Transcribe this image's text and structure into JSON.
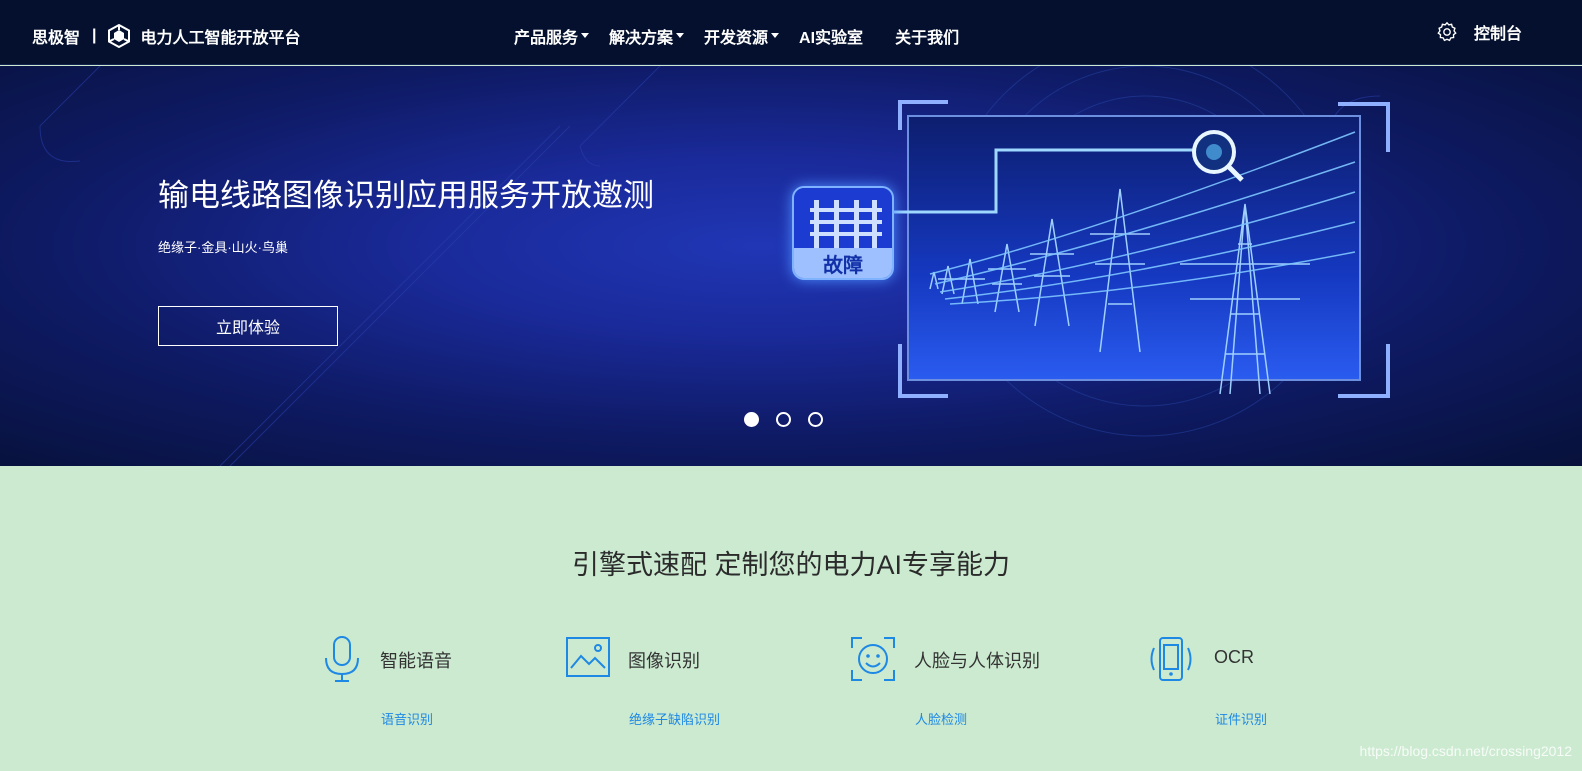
{
  "nav": {
    "brand_name": "思极智",
    "separator": "|",
    "platform_name": "电力人工智能开放平台",
    "menu": [
      {
        "label": "产品服务",
        "has_dropdown": true
      },
      {
        "label": "解决方案",
        "has_dropdown": true
      },
      {
        "label": "开发资源",
        "has_dropdown": true
      },
      {
        "label": "AI实验室",
        "has_dropdown": false
      },
      {
        "label": "关于我们",
        "has_dropdown": false
      }
    ],
    "console_label": "控制台",
    "console_icon": "gear-icon"
  },
  "hero": {
    "title": "输电线路图像识别应用服务开放邀测",
    "subtitle": "绝缘子·金具·山火·鸟巢",
    "button_label": "立即体验",
    "badge_label": "故障",
    "carousel_active_index": 0,
    "carousel_count": 3
  },
  "features": {
    "title": "引擎式速配 定制您的电力AI专享能力",
    "items": [
      {
        "icon": "microphone-icon",
        "name": "智能语音",
        "link": "语音识别"
      },
      {
        "icon": "image-icon",
        "name": "图像识别",
        "link": "绝缘子缺陷识别"
      },
      {
        "icon": "face-icon",
        "name": "人脸与人体识别",
        "link": "人脸检测"
      },
      {
        "icon": "phone-icon",
        "name": "OCR",
        "link": "证件识别"
      }
    ]
  },
  "colors": {
    "nav_bg": "#04102d",
    "hero_bg": "#1a2a9a",
    "section_bg": "#cbead0",
    "accent": "#1e88e5"
  },
  "watermark": "https://blog.csdn.net/crossing2012"
}
